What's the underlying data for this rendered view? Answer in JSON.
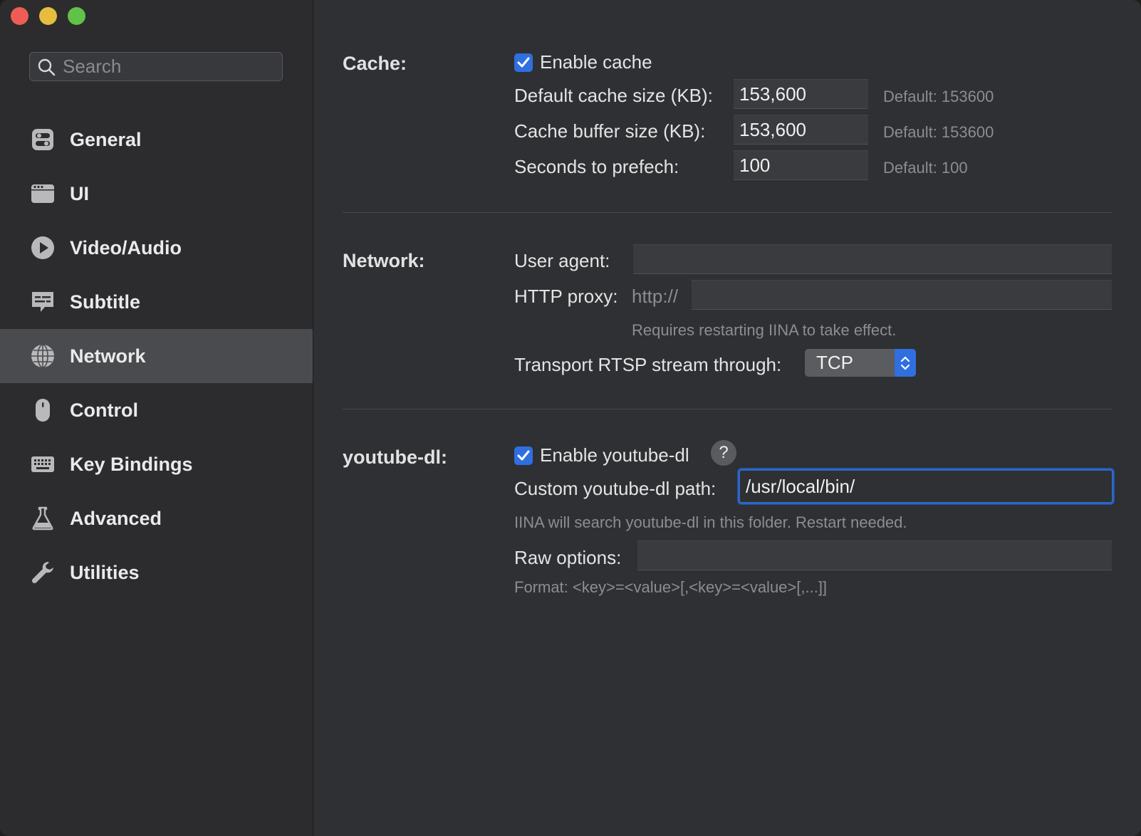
{
  "sidebar": {
    "search_placeholder": "Search",
    "items": [
      {
        "label": "General",
        "icon": "toggles-icon"
      },
      {
        "label": "UI",
        "icon": "window-icon"
      },
      {
        "label": "Video/Audio",
        "icon": "play-icon"
      },
      {
        "label": "Subtitle",
        "icon": "subtitle-icon"
      },
      {
        "label": "Network",
        "icon": "globe-icon",
        "selected": true
      },
      {
        "label": "Control",
        "icon": "mouse-icon"
      },
      {
        "label": "Key Bindings",
        "icon": "keyboard-icon"
      },
      {
        "label": "Advanced",
        "icon": "flask-icon"
      },
      {
        "label": "Utilities",
        "icon": "wrench-icon"
      }
    ]
  },
  "cache": {
    "title": "Cache:",
    "enable_label": "Enable cache",
    "enable_checked": true,
    "default_size_label": "Default cache size (KB):",
    "default_size_value": "153,600",
    "default_size_hint": "Default: 153600",
    "buffer_size_label": "Cache buffer size (KB):",
    "buffer_size_value": "153,600",
    "buffer_size_hint": "Default: 153600",
    "prefetch_label": "Seconds to prefech:",
    "prefetch_value": "100",
    "prefetch_hint": "Default: 100"
  },
  "network": {
    "title": "Network:",
    "user_agent_label": "User agent:",
    "user_agent_value": "",
    "proxy_label": "HTTP proxy:",
    "proxy_prefix": "http://",
    "proxy_value": "",
    "proxy_note": "Requires restarting IINA to take effect.",
    "rtsp_label": "Transport RTSP stream through:",
    "rtsp_value": "TCP"
  },
  "ytdl": {
    "title": "youtube-dl:",
    "enable_label": "Enable youtube-dl",
    "enable_checked": true,
    "help": "?",
    "path_label": "Custom youtube-dl path:",
    "path_value": "/usr/local/bin/",
    "path_note": "IINA will search youtube-dl in this folder. Restart needed.",
    "raw_label": "Raw options:",
    "raw_value": "",
    "raw_note": "Format: <key>=<value>[,<key>=<value>[,...]]"
  },
  "colors": {
    "accent": "#2f6fe0",
    "selected_row": "#4a4b4e"
  }
}
